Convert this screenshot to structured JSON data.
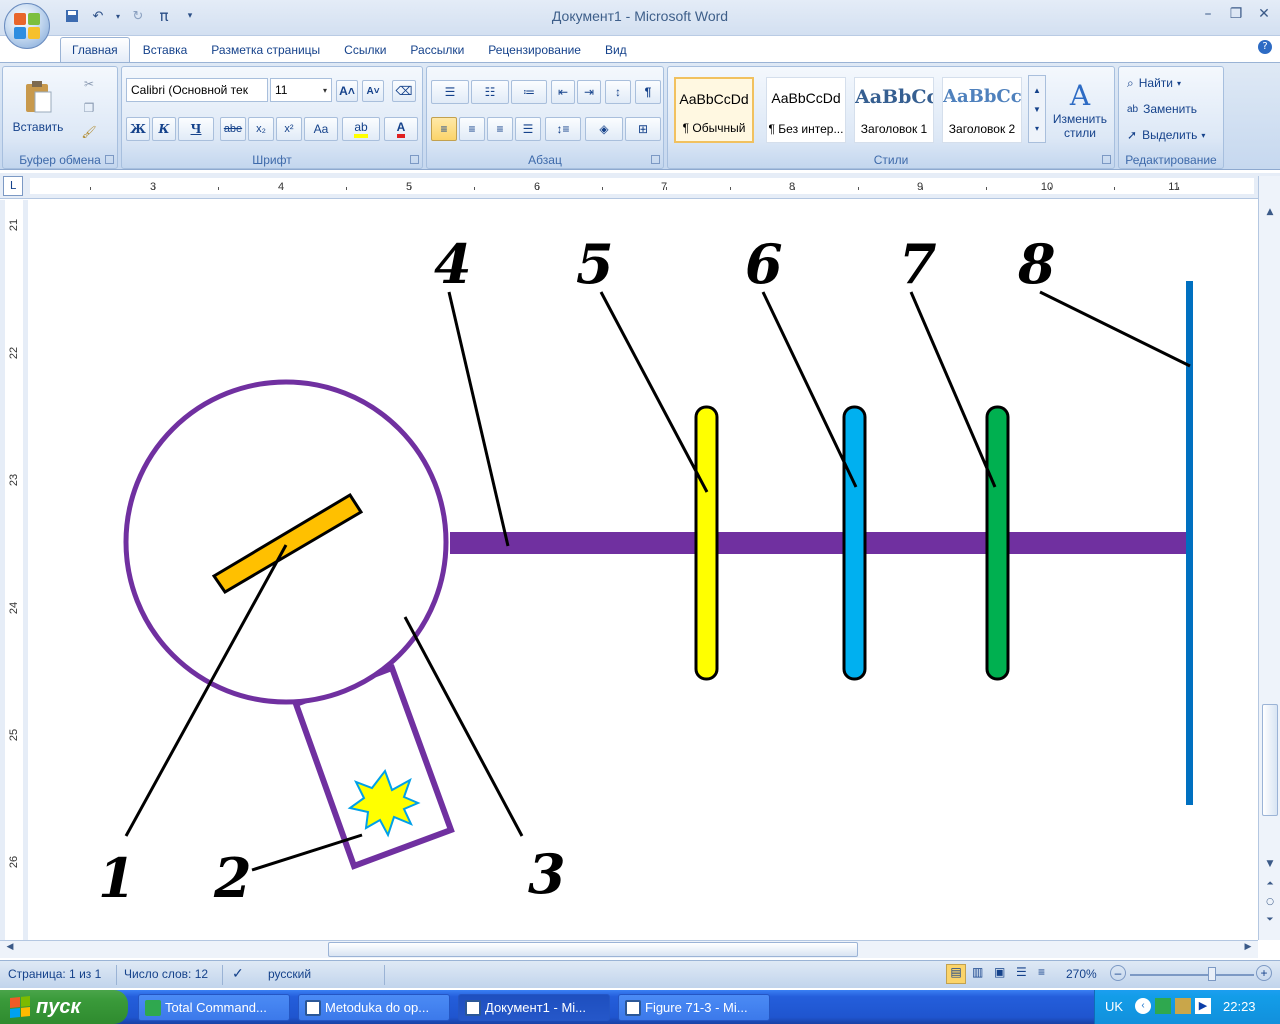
{
  "window": {
    "title": "Документ1 - Microsoft Word"
  },
  "tabs": [
    "Главная",
    "Вставка",
    "Разметка страницы",
    "Ссылки",
    "Рассылки",
    "Рецензирование",
    "Вид"
  ],
  "clipboard": {
    "paste_label": "Вставить",
    "group_label": "Буфер обмена"
  },
  "font": {
    "name": "Calibri (Основной тек",
    "size": "11",
    "group_label": "Шрифт",
    "buttons": [
      "Ж",
      "К",
      "Ч",
      "abe",
      "x₂",
      "x²",
      "Aa"
    ]
  },
  "paragraph": {
    "group_label": "Абзац"
  },
  "styles": {
    "group_label": "Стили",
    "items": [
      {
        "sample": "AaBbCcDd",
        "name": "¶ Обычный"
      },
      {
        "sample": "AaBbCcDd",
        "name": "¶ Без интер..."
      },
      {
        "sample": "AaBbCc",
        "name": "Заголовок 1"
      },
      {
        "sample": "AaBbCc",
        "name": "Заголовок 2"
      }
    ],
    "change_label": "Изменить стили"
  },
  "editing": {
    "group_label": "Редактирование",
    "find": "Найти",
    "replace": "Заменить",
    "select": "Выделить"
  },
  "ruler": {
    "h_numbers": [
      "3",
      "4",
      "5",
      "6",
      "7",
      "8",
      "9",
      "10",
      "11"
    ],
    "v_numbers": [
      "21",
      "22",
      "23",
      "24",
      "25",
      "26"
    ]
  },
  "figure": {
    "labels": [
      "1",
      "2",
      "3",
      "4",
      "5",
      "6",
      "7",
      "8"
    ],
    "colors": {
      "outline": "#7030a0",
      "beam": "#7030a0",
      "mirror": "#ffc000",
      "spark": "#ffff00",
      "plate5": "#ffff00",
      "plate6": "#00b0f0",
      "plate7": "#00b050",
      "screen": "#0070c0"
    }
  },
  "status": {
    "page": "Страница: 1 из 1",
    "words": "Число слов: 12",
    "language": "русский",
    "zoom": "270%"
  },
  "taskbar": {
    "start": "пуск",
    "tasks": [
      "Total Command...",
      "Metoduka do op...",
      "Документ1 - Mi...",
      "Figure 71-3 - Mi..."
    ],
    "lang": "UK",
    "time": "22:23"
  }
}
